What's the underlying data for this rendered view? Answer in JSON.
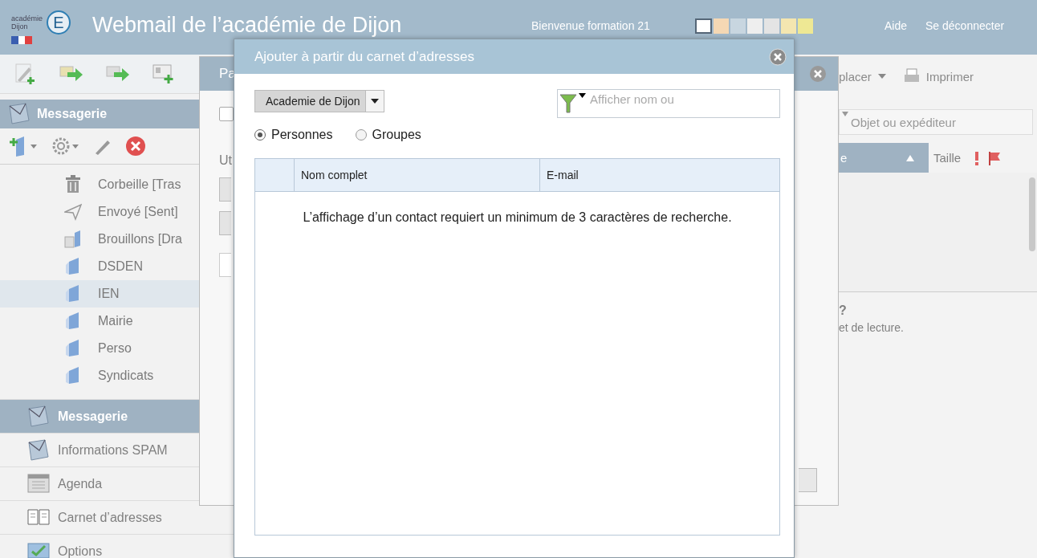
{
  "header": {
    "logo_text": [
      "académie",
      "Dijon"
    ],
    "logo_letter": "E",
    "title": "Webmail de l’académie de Dijon",
    "welcome": "Bienvenue formation 21",
    "theme_swatches": [
      {
        "color": "#ffffff",
        "selected": true
      },
      {
        "color": "#f5d8b4",
        "selected": false
      },
      {
        "color": "#c8d6e0",
        "selected": false
      },
      {
        "color": "#eeeeee",
        "selected": false
      },
      {
        "color": "#e4e4e4",
        "selected": false
      },
      {
        "color": "#f4e6b0",
        "selected": false
      },
      {
        "color": "#eee894",
        "selected": false
      }
    ],
    "links": [
      "Aide",
      "Se déconnecter"
    ]
  },
  "sidebar": {
    "section_title": "Messagerie",
    "folders": [
      {
        "label": "Corbeille [Tras",
        "kind": "trash",
        "selected": false
      },
      {
        "label": "Envoyé [Sent]",
        "kind": "sent",
        "selected": false
      },
      {
        "label": "Brouillons [Dra",
        "kind": "drafts",
        "selected": false
      },
      {
        "label": "DSDEN",
        "kind": "folder",
        "selected": false
      },
      {
        "label": "IEN",
        "kind": "folder",
        "selected": true
      },
      {
        "label": "Mairie",
        "kind": "folder",
        "selected": false
      },
      {
        "label": "Perso",
        "kind": "folder",
        "selected": false
      },
      {
        "label": "Syndicats",
        "kind": "folder",
        "selected": false
      }
    ],
    "panels": [
      {
        "label": "Messagerie",
        "kind": "mail",
        "selected": true
      },
      {
        "label": "Informations SPAM",
        "kind": "mail",
        "selected": false
      },
      {
        "label": "Agenda",
        "kind": "calendar",
        "selected": false
      },
      {
        "label": "Carnet d’adresses",
        "kind": "book",
        "selected": false
      },
      {
        "label": "Options",
        "kind": "options",
        "selected": false
      }
    ]
  },
  "main": {
    "menu": [
      {
        "label": "placer",
        "kind": "dropdown"
      },
      {
        "label": "Imprimer",
        "kind": "print"
      }
    ],
    "search": {
      "placeholder": "Objet ou expéditeur"
    },
    "columns": [
      {
        "label": "e",
        "sorted": true
      },
      {
        "label": "Taille",
        "sorted": false
      }
    ],
    "preview": {
      "title": "?",
      "text": "et de lecture."
    }
  },
  "back_dialog": {
    "title": "Pa",
    "checked": false,
    "label": "Ut"
  },
  "dialog": {
    "title": "Ajouter à partir du carnet d’adresses",
    "source": "Academie de Dijon",
    "filter": {
      "placeholder": "Afficher nom ou"
    },
    "types": [
      {
        "label": "Personnes",
        "selected": true
      },
      {
        "label": "Groupes",
        "selected": false
      }
    ],
    "columns": [
      "Nom complet",
      "E-mail"
    ],
    "message": "L’affichage d’un contact requiert un minimum de 3 caractères de recherche."
  }
}
